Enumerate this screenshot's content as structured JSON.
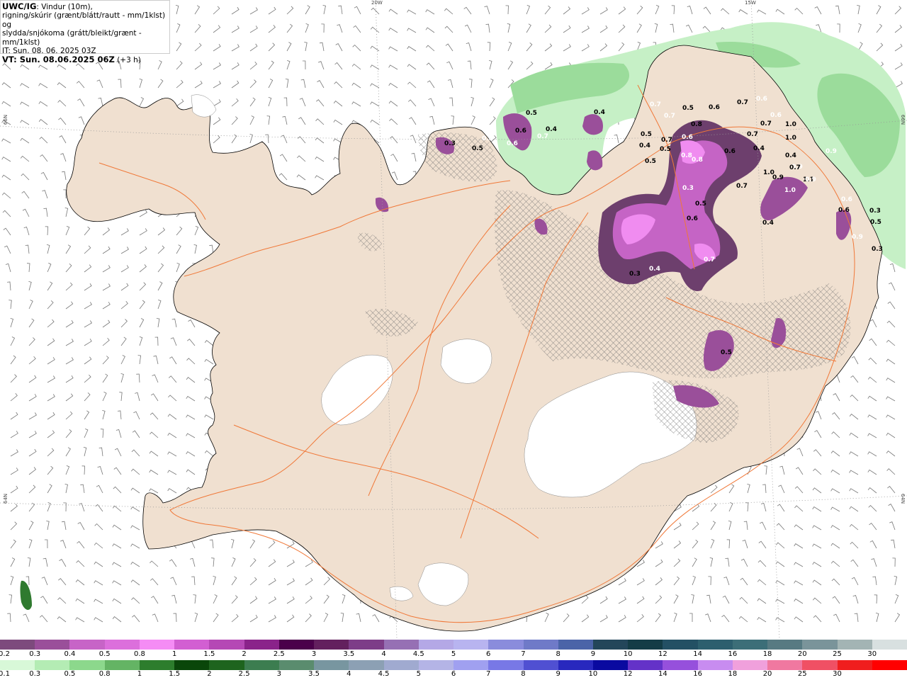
{
  "header": {
    "product": "UWC/IG",
    "line1_rest": ": Vindur (10m),",
    "line2": "rigning/skúrir (grænt/blátt/rautt - mm/1klst) og",
    "line3": "slydda/snjókoma (grátt/bleikt/grænt - mm/1klst)",
    "it": "IT: Sun. 08. 06. 2025 03Z",
    "vt_label": "VT: Sun. 08.06.2025 06Z",
    "vt_offset": " (+3 h)"
  },
  "graticule": {
    "lon_top": [
      "20W",
      "15W"
    ],
    "lat_left": [
      "66N",
      "64N"
    ],
    "lat_right": [
      "66N",
      "64N"
    ]
  },
  "contour_labels": [
    "0.7",
    "0.5",
    "0.4",
    "0.6",
    "0.3",
    "0.5",
    "0.7",
    "0.6",
    "0.4",
    "0.5",
    "0.8",
    "0.6",
    "0.7",
    "0.5",
    "0.7",
    "0.6",
    "0.4",
    "0.5",
    "0.8",
    "0.6",
    "0.4",
    "0.9",
    "0.4",
    "1.0",
    "0.6",
    "0.7",
    "1.0",
    "0.9",
    "1.0",
    "1.1",
    "1.0",
    "0.9",
    "0.7",
    "0.6",
    "0.5",
    "0.3",
    "0.9",
    "0.3",
    "0.4",
    "0.7",
    "0.6",
    "0.5",
    "0.3",
    "0.5",
    "0.3",
    "0.4",
    "0.5",
    "0.7",
    "0.9",
    "0.7",
    "0.6",
    "0.6",
    "0.7",
    "0.5",
    "0.8"
  ],
  "legend_snow": {
    "labels": [
      "0.2",
      "0.3",
      "0.4",
      "0.5",
      "0.8",
      "1",
      "1.5",
      "2",
      "2.5",
      "3",
      "3.5",
      "4",
      "4.5",
      "5",
      "6",
      "7",
      "8",
      "9",
      "10",
      "12",
      "14",
      "16",
      "18",
      "20",
      "25",
      "30"
    ],
    "colors": [
      "#7d4a7d",
      "#9a4f9a",
      "#c764c7",
      "#dc6fdc",
      "#f58cf5",
      "#d25fd2",
      "#b548b5",
      "#8a238a",
      "#4a004a",
      "#63205e",
      "#7d3d88",
      "#9670b4",
      "#b4a8e6",
      "#b8b4f0",
      "#8a8cdc",
      "#6f7ac8",
      "#4b64a8",
      "#23465a",
      "#143c46",
      "#235064",
      "#2d5f6e",
      "#3c6e78",
      "#577a82",
      "#7a949a",
      "#a3b4b4",
      "#d8e0e0"
    ]
  },
  "legend_rain": {
    "labels": [
      "0.1",
      "0.3",
      "0.5",
      "0.8",
      "1",
      "1.5",
      "2",
      "2.5",
      "3",
      "3.5",
      "4",
      "4.5",
      "5",
      "6",
      "7",
      "8",
      "9",
      "10",
      "12",
      "14",
      "16",
      "18",
      "20",
      "25",
      "30"
    ],
    "colors": [
      "#d8f8d8",
      "#b4ecb4",
      "#8cd88c",
      "#64b464",
      "#2d7d2d",
      "#0a460a",
      "#1e641e",
      "#3c7d50",
      "#5a8c6e",
      "#7896a0",
      "#8ca0b4",
      "#a0aad0",
      "#b4b4e6",
      "#a0a0f0",
      "#7878e6",
      "#5050d2",
      "#2828be",
      "#0a0aa0",
      "#6432c8",
      "#9650dc",
      "#c88cf0",
      "#f0a0dc",
      "#f078a0",
      "#f05064",
      "#f01e1e",
      "#ff0000"
    ]
  },
  "colors": {
    "land": "#f0e0d0",
    "ice": "#ffffff",
    "roads": "#f07838",
    "rain_light": "#c8f0c8",
    "snow_mid": "#c060c0",
    "snow_dark": "#6a3a6a",
    "hatch": "#777777"
  }
}
